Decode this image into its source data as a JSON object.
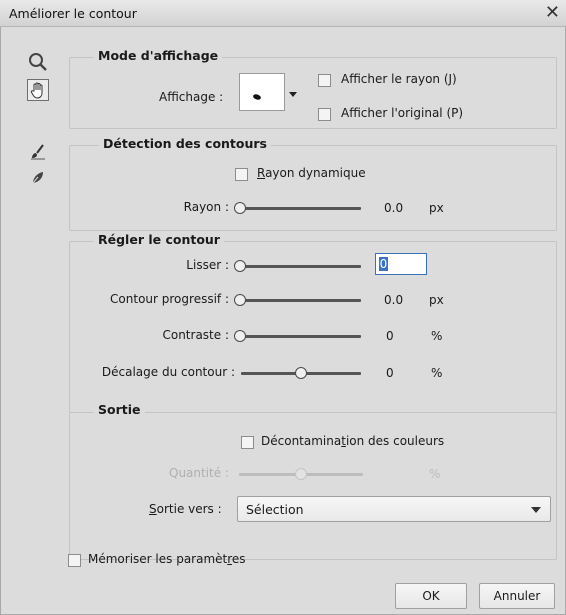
{
  "window": {
    "title": "Améliorer le contour",
    "close_glyph": "✕"
  },
  "tools": [
    {
      "name": "zoom-tool",
      "icon": "magnifier-icon"
    },
    {
      "name": "hand-tool",
      "icon": "hand-icon",
      "active": true
    },
    {
      "name": "refine-radius-tool",
      "icon": "brush-icon"
    },
    {
      "name": "erase-refinements-tool",
      "icon": "eraser-brush-icon"
    }
  ],
  "display_mode": {
    "title": "Mode d'affichage",
    "view_label": "Affichage :",
    "show_radius": {
      "label": "Afficher le rayon (J)",
      "checked": false
    },
    "show_original": {
      "label": "Afficher l'original (P)",
      "checked": false
    }
  },
  "edge_detection": {
    "title": "Détection des contours",
    "smart_radius": {
      "label": "Rayon dynamique",
      "checked": false
    },
    "radius": {
      "label": "Rayon :",
      "value": "0.0",
      "unit": "px",
      "level": 0
    }
  },
  "adjust_edge": {
    "title": "Régler le contour",
    "smooth": {
      "label": "Lisser :",
      "value": "0",
      "level": 0
    },
    "feather": {
      "label": "Contour progressif :",
      "value": "0.0",
      "unit": "px",
      "level": 0
    },
    "contrast": {
      "label": "Contraste :",
      "value": "0",
      "unit": "%",
      "level": 0
    },
    "shift_edge": {
      "label": "Décalage du contour :",
      "value": "0",
      "unit": "%",
      "level": 0.5
    }
  },
  "output": {
    "title": "Sortie",
    "decontaminate": {
      "label": "Décontamination des couleurs",
      "checked": false
    },
    "amount": {
      "label": "Quantité :",
      "unit": "%",
      "level": 0.5,
      "disabled": true
    },
    "output_to": {
      "label": "Sortie vers :",
      "value": "Sélection"
    }
  },
  "remember": {
    "label": "Mémoriser les paramètres",
    "checked": false
  },
  "buttons": {
    "ok": "OK",
    "cancel": "Annuler"
  }
}
